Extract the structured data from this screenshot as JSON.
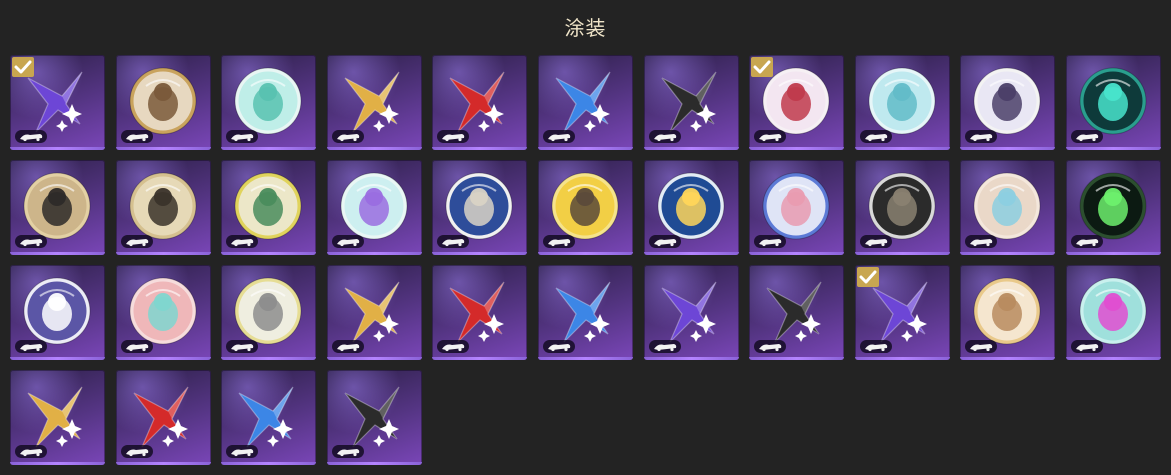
{
  "header": {
    "title": "涂装"
  },
  "tiles": [
    {
      "kind": "star",
      "color": "#6d46d6",
      "label": "purple-star-skin",
      "selected": true
    },
    {
      "kind": "medal",
      "bg": "#e7d8c0",
      "ring": "#c9a35d",
      "accent": "#7a5a3a",
      "label": "white-hair-character-skin"
    },
    {
      "kind": "medal",
      "bg": "#bfeee8",
      "ring": "#e8f6f4",
      "accent": "#58c2b0",
      "label": "aurora-skin"
    },
    {
      "kind": "star",
      "color": "#e1b046",
      "label": "gold-star-skin"
    },
    {
      "kind": "star",
      "color": "#d42a2a",
      "label": "red-star-skin"
    },
    {
      "kind": "star",
      "color": "#3c86e6",
      "label": "blue-star-skin"
    },
    {
      "kind": "star",
      "color": "#2b2b2b",
      "label": "black-star-skin"
    },
    {
      "kind": "medal",
      "bg": "#f3e6f1",
      "ring": "#f6f0f4",
      "accent": "#c03a4c",
      "label": "swirl-skin",
      "selected": true
    },
    {
      "kind": "medal",
      "bg": "#bfe9ef",
      "ring": "#e6f6f8",
      "accent": "#62bcc8",
      "label": "crystal-skin"
    },
    {
      "kind": "medal",
      "bg": "#e9e7f4",
      "ring": "#f3f3f3",
      "accent": "#4b3f68",
      "label": "orb-skin"
    },
    {
      "kind": "medal",
      "bg": "#0e3a3a",
      "ring": "#2a9e8e",
      "accent": "#48e4cc",
      "label": "teal-logo-skin"
    },
    {
      "kind": "medal",
      "bg": "#cdb58a",
      "ring": "#e3d0a4",
      "accent": "#2d2a28",
      "label": "gold-crest-skin"
    },
    {
      "kind": "medal",
      "bg": "#e6d9b7",
      "ring": "#d5c08f",
      "accent": "#3a332a",
      "label": "comb-crest-skin"
    },
    {
      "kind": "medal",
      "bg": "#ece7c8",
      "ring": "#e0d35c",
      "accent": "#4a8c5d",
      "label": "blonde-character-skin"
    },
    {
      "kind": "medal",
      "bg": "#cdeff0",
      "ring": "#e9f7f5",
      "accent": "#9a6de0",
      "label": "planet-skin"
    },
    {
      "kind": "medal",
      "bg": "#2e4d9a",
      "ring": "#f1f1f1",
      "accent": "#d9d3c5",
      "label": "penguin-skin"
    },
    {
      "kind": "medal",
      "bg": "#f2cf45",
      "ring": "#f5e38b",
      "accent": "#5b4a3a",
      "label": "cow-character-skin"
    },
    {
      "kind": "medal",
      "bg": "#1f4b94",
      "ring": "#e3ecf5",
      "accent": "#ffd65a",
      "label": "cake-skin"
    },
    {
      "kind": "medal",
      "bg": "#dfe4f6",
      "ring": "#5c7ad6",
      "accent": "#e99bb0",
      "label": "pink-character-skin"
    },
    {
      "kind": "medal",
      "bg": "#2b2b2b",
      "ring": "#d9d9d9",
      "accent": "#8a8171",
      "label": "ruins-skin"
    },
    {
      "kind": "medal",
      "bg": "#ead8c8",
      "ring": "#f4e7dc",
      "accent": "#8ccfe0",
      "label": "ice-figure-skin"
    },
    {
      "kind": "medal",
      "bg": "#0c1a12",
      "ring": "#2c4f2f",
      "accent": "#6df06d",
      "label": "green-burst-skin"
    },
    {
      "kind": "medal",
      "bg": "#5b56a6",
      "ring": "#ececf6",
      "accent": "#ffffff",
      "label": "ornate-crest-skin"
    },
    {
      "kind": "medal",
      "bg": "#efb7b9",
      "ring": "#f6dcdc",
      "accent": "#7fd6cf",
      "label": "pastel-cat-skin"
    },
    {
      "kind": "medal",
      "bg": "#efeee0",
      "ring": "#e6dd94",
      "accent": "#8d8d8d",
      "label": "dice-skin"
    },
    {
      "kind": "star",
      "color": "#e1b046",
      "label": "gold-star-skin-2"
    },
    {
      "kind": "star",
      "color": "#d42a2a",
      "label": "red-star-skin-2"
    },
    {
      "kind": "star",
      "color": "#3c86e6",
      "label": "blue-star-skin-2"
    },
    {
      "kind": "star",
      "color": "#6d46d6",
      "label": "purple-star-skin-2"
    },
    {
      "kind": "star",
      "color": "#2b2b2b",
      "label": "black-star-skin-2"
    },
    {
      "kind": "star",
      "color": "#6d46d6",
      "label": "purple-star-skin-3",
      "selected": true
    },
    {
      "kind": "medal",
      "bg": "#f5e6cf",
      "ring": "#e9c98a",
      "accent": "#b88b5f",
      "label": "blonde-girl-skin"
    },
    {
      "kind": "medal",
      "bg": "#9fe0dc",
      "ring": "#c9f0ee",
      "accent": "#e04ed1",
      "label": "pink-cat-skin"
    },
    {
      "kind": "star",
      "color": "#e1b046",
      "label": "gold-star-skin-3"
    },
    {
      "kind": "star",
      "color": "#d42a2a",
      "label": "red-star-skin-3"
    },
    {
      "kind": "star",
      "color": "#3c86e6",
      "label": "blue-star-skin-3"
    },
    {
      "kind": "star",
      "color": "#2b2b2b",
      "label": "black-star-skin-3"
    }
  ]
}
